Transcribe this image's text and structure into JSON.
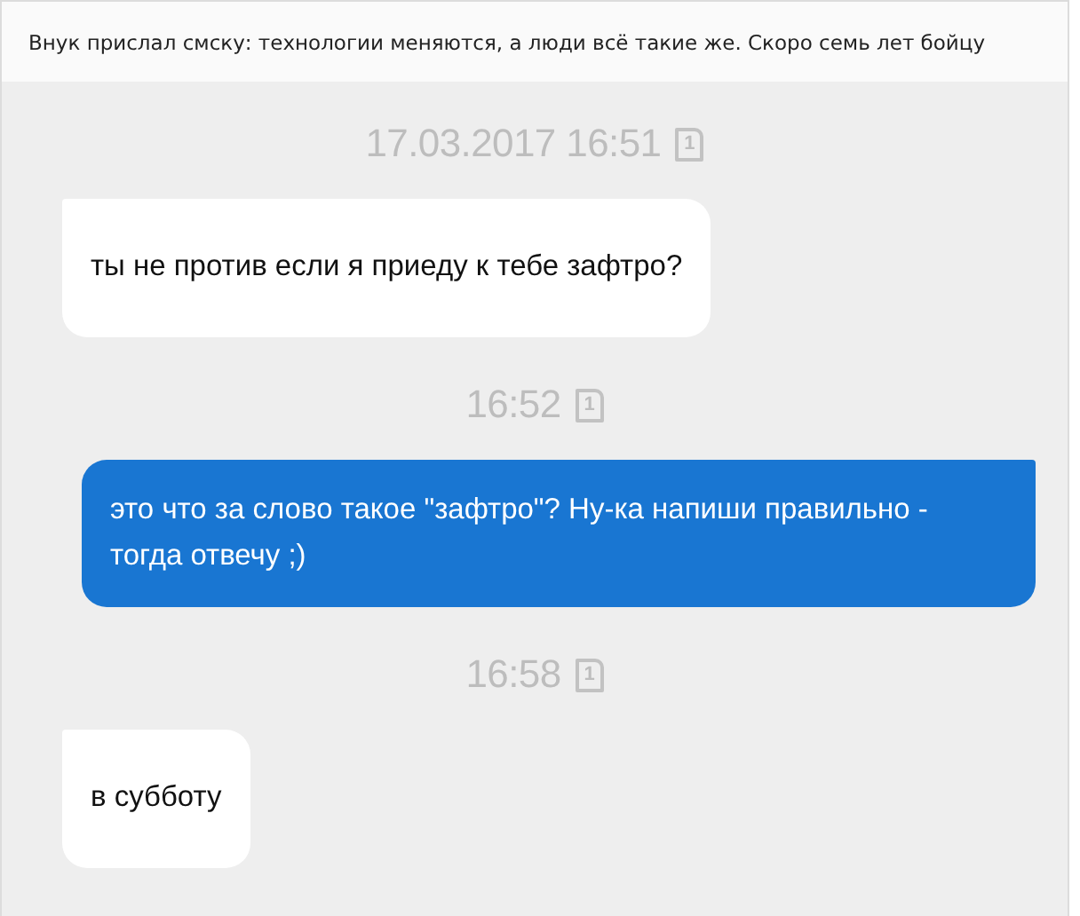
{
  "post": {
    "title": "Внук прислал смску: технологии меняются, а люди всё такие же. Скоро семь лет бойцу"
  },
  "conversation": [
    {
      "kind": "timestamp",
      "text": "17.03.2017 16:51",
      "sim": "1"
    },
    {
      "kind": "message",
      "sent": false,
      "text": "ты не против если я приеду к тебе зафтро?"
    },
    {
      "kind": "timestamp",
      "text": "16:52",
      "sim": "1"
    },
    {
      "kind": "message",
      "sent": true,
      "text": "это что за слово такое \"зафтро\"? Ну-ка напиши правильно - тогда отвечу ;)"
    },
    {
      "kind": "timestamp",
      "text": "16:58",
      "sim": "1"
    },
    {
      "kind": "message",
      "sent": false,
      "text": "в субботу"
    }
  ]
}
